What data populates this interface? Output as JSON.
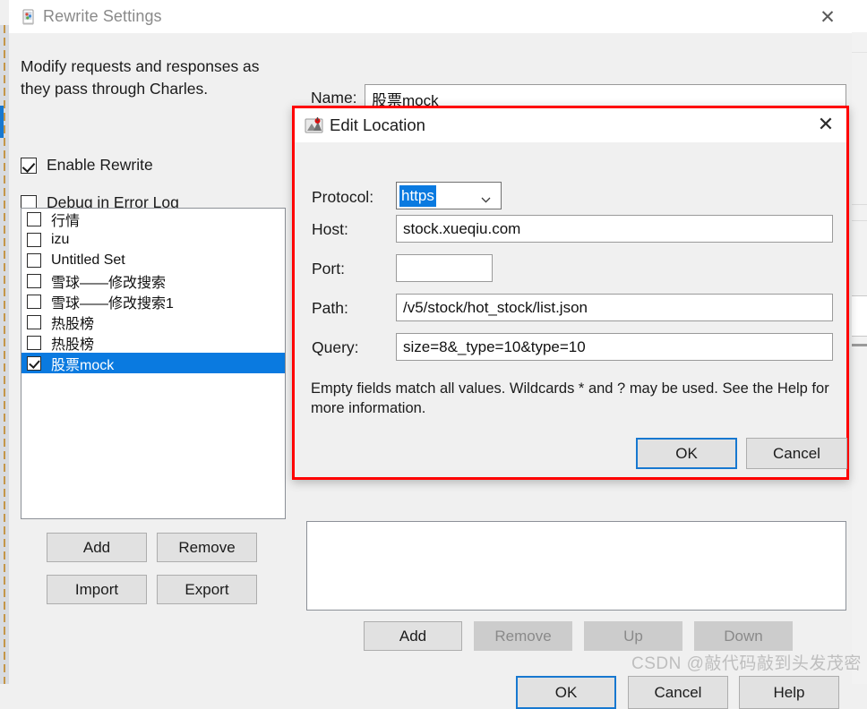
{
  "window": {
    "title": "Rewrite Settings",
    "title_icon": "charles-cup-icon",
    "close_label": "✕"
  },
  "left_pane": {
    "description": "Modify requests and responses as they pass through Charles.",
    "checkboxes": [
      {
        "label": "Enable Rewrite",
        "checked": true
      },
      {
        "label": "Debug in Error Log",
        "checked": false
      }
    ],
    "list_items": [
      {
        "label": "行情",
        "checked": false,
        "selected": false
      },
      {
        "label": "izu",
        "checked": false,
        "selected": false
      },
      {
        "label": "Untitled Set",
        "checked": false,
        "selected": false
      },
      {
        "label": "雪球——修改搜索",
        "checked": false,
        "selected": false
      },
      {
        "label": "雪球——修改搜索1",
        "checked": false,
        "selected": false
      },
      {
        "label": "热股榜",
        "checked": false,
        "selected": false
      },
      {
        "label": "热股榜",
        "checked": false,
        "selected": false
      },
      {
        "label": "股票mock",
        "checked": true,
        "selected": true
      }
    ],
    "buttons": [
      {
        "label": "Add"
      },
      {
        "label": "Remove"
      },
      {
        "label": "Import"
      },
      {
        "label": "Export"
      }
    ]
  },
  "right_pane": {
    "name_label": "Name:",
    "name_value": "股票mock",
    "list_buttons": [
      {
        "label": "Add",
        "enabled": true
      },
      {
        "label": "Remove",
        "enabled": false
      },
      {
        "label": "Up",
        "enabled": false
      },
      {
        "label": "Down",
        "enabled": false
      }
    ],
    "footer_buttons": [
      {
        "label": "OK",
        "enabled": true,
        "primary": true
      },
      {
        "label": "Cancel",
        "enabled": true,
        "primary": false
      },
      {
        "label": "Help",
        "enabled": true,
        "primary": false
      }
    ]
  },
  "dialog": {
    "title": "Edit Location",
    "title_icon": "charles-location-icon",
    "close_label": "✕",
    "fields": [
      {
        "label": "Protocol:",
        "value": "https",
        "type": "combobox",
        "selected_text": true
      },
      {
        "label": "Host:",
        "value": "stock.xueqiu.com",
        "type": "text"
      },
      {
        "label": "Port:",
        "value": "",
        "type": "text"
      },
      {
        "label": "Path:",
        "value": "/v5/stock/hot_stock/list.json",
        "type": "text"
      },
      {
        "label": "Query:",
        "value": "size=8&_type=10&type=10",
        "type": "text"
      }
    ],
    "hint": "Empty fields match all values. Wildcards * and ? may be used. See the Help for more information.",
    "ok_label": "OK",
    "cancel_label": "Cancel",
    "border_color": "#ff0000"
  },
  "watermark": "CSDN @敲代码敲到头发茂密",
  "colors": {
    "accent_blue": "#0a7ae0",
    "focus_blue": "#1778d0",
    "dialog_border_red": "#ff0000",
    "window_bg": "#f0f0f0",
    "button_bg": "#e1e1e1",
    "disabled_bg": "#cccccc"
  }
}
